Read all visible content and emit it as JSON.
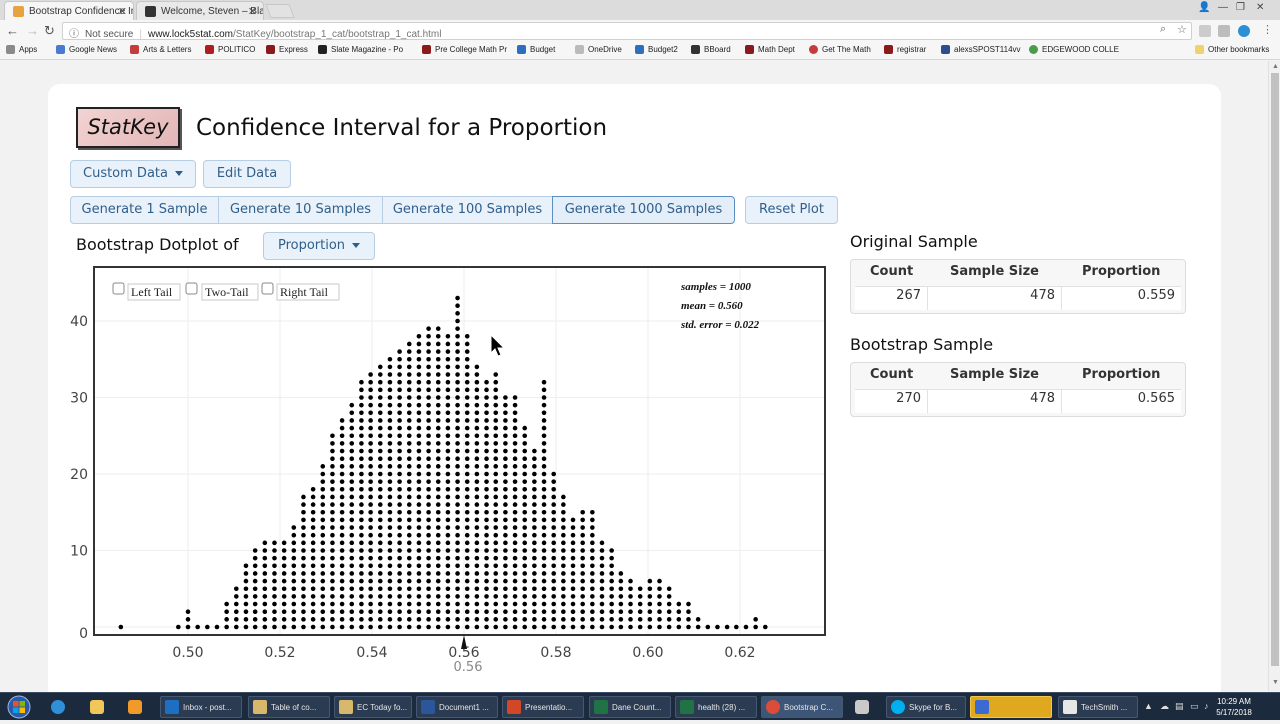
{
  "browser": {
    "tabs": [
      {
        "title": "Bootstrap Confidence In",
        "active": true
      },
      {
        "title": "Welcome, Steven – Black",
        "active": false
      }
    ],
    "not_secure": "Not secure",
    "url_host": "www.lock5stat.com",
    "url_path": "/StatKey/bootstrap_1_cat/bootstrap_1_cat.html",
    "bookmarks": [
      {
        "label": "Apps",
        "color": "#777"
      },
      {
        "label": "Google News",
        "color": "#4a7bd1"
      },
      {
        "label": "Arts & Letters",
        "color": "#c43c3c"
      },
      {
        "label": "POLITICO",
        "color": "#b11d1d"
      },
      {
        "label": "Express",
        "color": "#8b1a1a"
      },
      {
        "label": "Slate Magazine - Po",
        "color": "#222"
      },
      {
        "label": "Pre College Math Pr",
        "color": "#8b1a1a"
      },
      {
        "label": "Budget",
        "color": "#2d6fbf"
      },
      {
        "label": "OneDrive",
        "color": "#999"
      },
      {
        "label": "Budget2",
        "color": "#2d6fbf"
      },
      {
        "label": "BBoard",
        "color": "#333"
      },
      {
        "label": "Math Dept",
        "color": "#8b1a1a"
      },
      {
        "label": "Get The Math",
        "color": "#c43c3c"
      },
      {
        "label": "registrar",
        "color": "#8b1a1a"
      },
      {
        "label": "alexsSPOST114vv",
        "color": "#2d4f8f"
      },
      {
        "label": "EDGEWOOD COLLE",
        "color": "#4c9a4c"
      }
    ],
    "other_bookmarks": "Other bookmarks"
  },
  "app": {
    "logo": "StatKey",
    "title": "Confidence Interval for a Proportion",
    "custom_data": "Custom Data",
    "edit_data": "Edit Data",
    "generate_1": "Generate 1 Sample",
    "generate_10": "Generate 10 Samples",
    "generate_100": "Generate 100 Samples",
    "generate_1000": "Generate 1000 Samples",
    "reset_plot": "Reset Plot",
    "dotplot_label": "Bootstrap Dotplot of",
    "dotplot_stat": "Proportion"
  },
  "original_sample": {
    "title": "Original Sample",
    "headers": [
      "Count",
      "Sample Size",
      "Proportion"
    ],
    "values": [
      "267",
      "478",
      "0.559"
    ]
  },
  "bootstrap_sample": {
    "title": "Bootstrap Sample",
    "headers": [
      "Count",
      "Sample Size",
      "Proportion"
    ],
    "values": [
      "270",
      "478",
      "0.565"
    ]
  },
  "chart_data": {
    "type": "scatter",
    "subtype": "dotplot",
    "tail_options": [
      "Left Tail",
      "Two-Tail",
      "Right Tail"
    ],
    "stats_text": [
      "samples = 1000",
      "mean = 0.560",
      "std. error = 0.022"
    ],
    "xlim": [
      0.485,
      0.63
    ],
    "ylim": [
      0,
      48
    ],
    "x_ticks": [
      "0.50",
      "0.52",
      "0.54",
      "0.56",
      "0.58",
      "0.60",
      "0.62"
    ],
    "y_ticks": [
      "0",
      "10",
      "20",
      "30",
      "40"
    ],
    "marker_label": "0.56",
    "marker_value": 0.56,
    "grid": true,
    "x_values": [
      0.4854,
      0.4979,
      0.5,
      0.5021,
      0.5042,
      0.5063,
      0.5084,
      0.5105,
      0.5126,
      0.5146,
      0.5167,
      0.5188,
      0.5209,
      0.523,
      0.5251,
      0.5272,
      0.5293,
      0.5314,
      0.5335,
      0.5356,
      0.5377,
      0.5397,
      0.5418,
      0.5439,
      0.546,
      0.5481,
      0.5502,
      0.5523,
      0.5544,
      0.5565,
      0.5586,
      0.5607,
      0.5628,
      0.5649,
      0.5669,
      0.569,
      0.5711,
      0.5732,
      0.5753,
      0.5774,
      0.5795,
      0.5816,
      0.5837,
      0.5858,
      0.5879,
      0.59,
      0.5921,
      0.5941,
      0.5962,
      0.5983,
      0.6004,
      0.6025,
      0.6046,
      0.6067,
      0.6088,
      0.6109,
      0.613,
      0.6151,
      0.6172,
      0.6192,
      0.6213,
      0.6234,
      0.6255
    ],
    "counts": [
      1,
      1,
      3,
      1,
      1,
      1,
      4,
      6,
      9,
      11,
      12,
      12,
      12,
      14,
      18,
      19,
      22,
      26,
      28,
      30,
      33,
      34,
      35,
      36,
      37,
      38,
      39,
      40,
      40,
      39,
      44,
      39,
      35,
      33,
      34,
      31,
      31,
      27,
      24,
      33,
      21,
      18,
      15,
      16,
      16,
      12,
      11,
      8,
      7,
      6,
      7,
      7,
      6,
      4,
      4,
      2,
      1,
      1,
      1,
      1,
      1,
      2,
      1
    ]
  },
  "taskbar": {
    "items": [
      "Inbox - post...",
      "Table of co...",
      "EC Today fo...",
      "Document1 ...",
      "Presentatio...",
      "Dane Count...",
      "health (28) ...",
      "Bootstrap C...",
      "Skype for B...",
      "TechSmith ..."
    ],
    "time": "10:29 AM",
    "date": "5/17/2018"
  }
}
